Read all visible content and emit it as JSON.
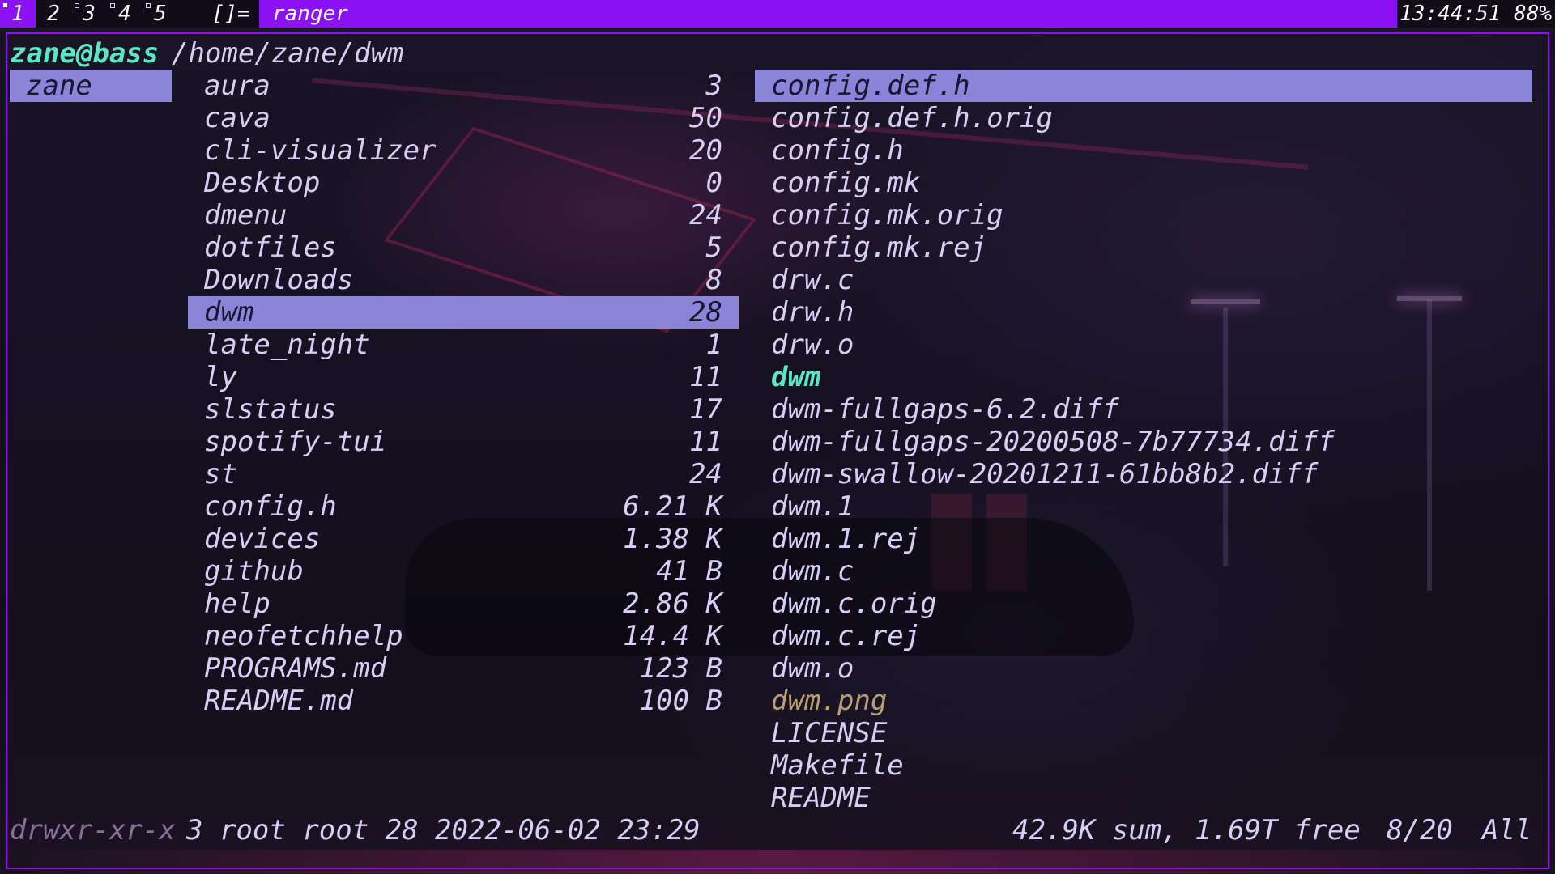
{
  "topbar": {
    "tags": [
      "1",
      "2",
      "3",
      "4",
      "5"
    ],
    "active_tag": "1",
    "layout_symbol": "[]=",
    "window_title": "ranger",
    "status": "13:44:51 88%"
  },
  "ranger": {
    "user_host": "zane@bass",
    "path": "/home/zane/dwm",
    "parent_selected": "zane",
    "current": [
      {
        "name": "aura",
        "size": "3"
      },
      {
        "name": "cava",
        "size": "50"
      },
      {
        "name": "cli-visualizer",
        "size": "20"
      },
      {
        "name": "Desktop",
        "size": "0"
      },
      {
        "name": "dmenu",
        "size": "24"
      },
      {
        "name": "dotfiles",
        "size": "5"
      },
      {
        "name": "Downloads",
        "size": "8"
      },
      {
        "name": "dwm",
        "size": "28"
      },
      {
        "name": "late_night",
        "size": "1"
      },
      {
        "name": "ly",
        "size": "11"
      },
      {
        "name": "slstatus",
        "size": "17"
      },
      {
        "name": "spotify-tui",
        "size": "11"
      },
      {
        "name": "st",
        "size": "24"
      },
      {
        "name": "config.h",
        "size": "6.21 K"
      },
      {
        "name": "devices",
        "size": "1.38 K"
      },
      {
        "name": "github",
        "size": "41 B"
      },
      {
        "name": "help",
        "size": "2.86 K"
      },
      {
        "name": "neofetchhelp",
        "size": "14.4 K"
      },
      {
        "name": "PROGRAMS.md",
        "size": "123 B"
      },
      {
        "name": "README.md",
        "size": "100 B"
      }
    ],
    "preview": [
      {
        "name": "config.def.h"
      },
      {
        "name": "config.def.h.orig"
      },
      {
        "name": "config.h"
      },
      {
        "name": "config.mk"
      },
      {
        "name": "config.mk.orig"
      },
      {
        "name": "config.mk.rej"
      },
      {
        "name": "drw.c"
      },
      {
        "name": "drw.h"
      },
      {
        "name": "drw.o"
      },
      {
        "name": "dwm"
      },
      {
        "name": "dwm-fullgaps-6.2.diff"
      },
      {
        "name": "dwm-fullgaps-20200508-7b77734.diff"
      },
      {
        "name": "dwm-swallow-20201211-61bb8b2.diff"
      },
      {
        "name": "dwm.1"
      },
      {
        "name": "dwm.1.rej"
      },
      {
        "name": "dwm.c"
      },
      {
        "name": "dwm.c.orig"
      },
      {
        "name": "dwm.c.rej"
      },
      {
        "name": "dwm.o"
      },
      {
        "name": "dwm.png"
      },
      {
        "name": "LICENSE"
      },
      {
        "name": "Makefile"
      },
      {
        "name": "README"
      }
    ],
    "statusline": {
      "permissions": "drwxr-xr-x",
      "meta": "3 root root 28 2022-06-02 23:29",
      "sum_free": "42.9K sum, 1.69T free",
      "position": "8/20",
      "scroll": "All"
    }
  }
}
